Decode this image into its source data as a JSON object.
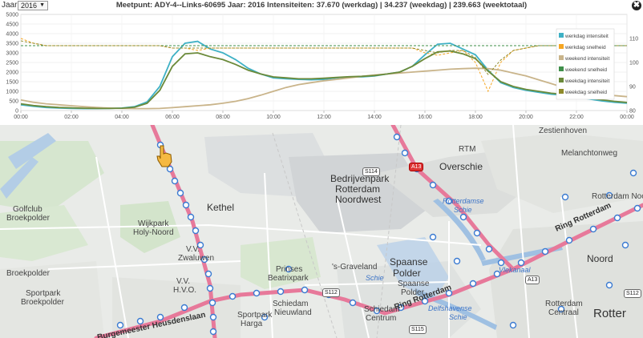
{
  "toolbar": {
    "year_label": "Jaar:",
    "year_value": "2016",
    "year_caret": "▼",
    "close_symbol": "✖",
    "title": "Meetpunt: ADY-4--Links-60695 Jaar: 2016 Intensiteiten: 37.670 (werkdag) | 34.237 (weekdag) | 239.663 (weektotaal)"
  },
  "chart_data": {
    "type": "line",
    "x_ticks": [
      "00:00",
      "02:00",
      "04:00",
      "06:00",
      "08:00",
      "10:00",
      "12:00",
      "14:00",
      "16:00",
      "18:00",
      "20:00",
      "22:00",
      "00:00"
    ],
    "y_left_ticks": [
      "0",
      "500",
      "1000",
      "1500",
      "2000",
      "2500",
      "3000",
      "3500",
      "4000",
      "4500",
      "5000"
    ],
    "y_right_ticks": [
      "80",
      "90",
      "100",
      "110"
    ],
    "ylim_left": [
      0,
      5000
    ],
    "ylim_right": [
      80,
      120
    ],
    "legend_position": "right",
    "x_hours": [
      0,
      0.5,
      1,
      1.5,
      2,
      2.5,
      3,
      3.5,
      4,
      4.5,
      5,
      5.5,
      6,
      6.5,
      7,
      7.5,
      8,
      8.5,
      9,
      9.5,
      10,
      10.5,
      11,
      11.5,
      12,
      12.5,
      13,
      13.5,
      14,
      14.5,
      15,
      15.5,
      16,
      16.5,
      17,
      17.5,
      18,
      18.5,
      19,
      19.5,
      20,
      20.5,
      21,
      21.5,
      22,
      22.5,
      23,
      23.5,
      24
    ],
    "series": [
      {
        "name": "werkdag intensiteit",
        "axis": "left",
        "color": "#3fb1c5",
        "width": 1.8,
        "dash": "",
        "values": [
          300,
          220,
          160,
          130,
          110,
          100,
          100,
          110,
          130,
          200,
          450,
          1250,
          2800,
          3500,
          3600,
          3200,
          3000,
          2650,
          2200,
          1900,
          1700,
          1650,
          1620,
          1600,
          1620,
          1700,
          1750,
          1750,
          1800,
          1900,
          2000,
          2300,
          2900,
          3450,
          3500,
          3200,
          2900,
          2100,
          1450,
          1200,
          1050,
          950,
          850,
          800,
          700,
          600,
          500,
          430,
          380
        ]
      },
      {
        "name": "werkdag snelheid",
        "axis": "right",
        "color": "#f5a623",
        "width": 1,
        "dash": "3,2",
        "values": [
          110,
          108,
          107,
          107,
          107,
          107,
          107,
          107,
          107,
          107,
          107,
          107,
          106,
          106,
          105,
          106,
          106,
          106,
          106,
          106,
          106,
          106,
          106,
          106,
          106,
          106,
          106,
          106,
          106,
          106,
          106,
          106,
          104,
          103,
          104,
          105,
          100,
          88,
          100,
          105,
          106,
          107,
          107,
          107,
          107,
          107,
          107,
          107,
          107
        ]
      },
      {
        "name": "weekend intensiteit",
        "axis": "left",
        "color": "#c9b48a",
        "width": 1.8,
        "dash": "",
        "values": [
          550,
          430,
          350,
          300,
          250,
          200,
          160,
          130,
          110,
          100,
          100,
          110,
          150,
          200,
          250,
          300,
          380,
          480,
          620,
          800,
          1000,
          1200,
          1350,
          1450,
          1550,
          1620,
          1700,
          1780,
          1850,
          1900,
          1950,
          2000,
          2050,
          2100,
          2150,
          2180,
          2200,
          2180,
          2100,
          1950,
          1800,
          1600,
          1400,
          1200,
          1050,
          950,
          850,
          780,
          720
        ]
      },
      {
        "name": "weekend snelheid",
        "axis": "right",
        "color": "#3f8f4a",
        "width": 1,
        "dash": "3,2",
        "values": [
          107,
          107,
          107,
          107,
          107,
          107,
          107,
          107,
          107,
          107,
          107,
          107,
          107,
          107,
          107,
          107,
          107,
          107,
          107,
          107,
          107,
          107,
          107,
          107,
          107,
          107,
          107,
          107,
          107,
          107,
          107,
          107,
          107,
          107,
          107,
          107,
          107,
          107,
          107,
          107,
          107,
          107,
          107,
          107,
          107,
          107,
          107,
          107,
          107
        ]
      },
      {
        "name": "weekdag intensiteit",
        "axis": "left",
        "color": "#6b8a3a",
        "width": 1.8,
        "dash": "",
        "values": [
          350,
          260,
          200,
          160,
          140,
          120,
          110,
          110,
          120,
          170,
          380,
          1050,
          2300,
          2950,
          3000,
          2800,
          2650,
          2400,
          2100,
          1900,
          1750,
          1700,
          1650,
          1650,
          1680,
          1720,
          1760,
          1780,
          1820,
          1900,
          2000,
          2300,
          2700,
          3050,
          3100,
          2950,
          2700,
          2050,
          1500,
          1250,
          1100,
          1000,
          900,
          850,
          750,
          650,
          560,
          480,
          420
        ]
      },
      {
        "name": "weekdag snelheid",
        "axis": "right",
        "color": "#8f8a2a",
        "width": 1,
        "dash": "3,2",
        "values": [
          109,
          108,
          107,
          107,
          107,
          107,
          107,
          107,
          107,
          107,
          107,
          107,
          106,
          106,
          106,
          106,
          106,
          106,
          106,
          106,
          106,
          106,
          106,
          106,
          106,
          106,
          106,
          106,
          106,
          106,
          106,
          106,
          105,
          104,
          105,
          105,
          102,
          95,
          101,
          105,
          106,
          107,
          107,
          107,
          107,
          107,
          107,
          107,
          107
        ]
      }
    ]
  },
  "map": {
    "labels": [
      {
        "text": "Zestienhoven",
        "kind": "normal"
      },
      {
        "text": "RTM",
        "kind": "normal"
      },
      {
        "text": "Melanchtonweg",
        "kind": "normal"
      },
      {
        "text": "Overschie",
        "kind": "big"
      },
      {
        "text": "Bedrijvenpark",
        "kind": "big"
      },
      {
        "text": "Rotterdam",
        "kind": "big"
      },
      {
        "text": "Noordwest",
        "kind": "big"
      },
      {
        "text": "Rotterdamse",
        "kind": "water"
      },
      {
        "text": "Schie",
        "kind": "water"
      },
      {
        "text": "Rotterdam Noord",
        "kind": "normal"
      },
      {
        "text": "Ring Rotterdam",
        "kind": "road"
      },
      {
        "text": "Golfclub",
        "kind": "normal"
      },
      {
        "text": "Broekpolder",
        "kind": "normal"
      },
      {
        "text": "Wijkpark",
        "kind": "normal"
      },
      {
        "text": "Holy-Noord",
        "kind": "normal"
      },
      {
        "text": "Kethel",
        "kind": "big"
      },
      {
        "text": "V.V.",
        "kind": "normal"
      },
      {
        "text": "Zwaluwen",
        "kind": "normal"
      },
      {
        "text": "Broekpolder",
        "kind": "normal"
      },
      {
        "text": "V.V.",
        "kind": "normal"
      },
      {
        "text": "H.V.O.",
        "kind": "normal"
      },
      {
        "text": "Prinses",
        "kind": "normal"
      },
      {
        "text": "Beatrixpark",
        "kind": "normal"
      },
      {
        "text": "'s-Graveland",
        "kind": "normal"
      },
      {
        "text": "Spaanse",
        "kind": "big"
      },
      {
        "text": "Polder",
        "kind": "big"
      },
      {
        "text": "Schie",
        "kind": "water"
      },
      {
        "text": "Spaanse",
        "kind": "normal"
      },
      {
        "text": "Polder",
        "kind": "normal"
      },
      {
        "text": "Noord",
        "kind": "big"
      },
      {
        "text": "Vlekanaal",
        "kind": "water"
      },
      {
        "text": "Sportpark",
        "kind": "normal"
      },
      {
        "text": "Broekpolder",
        "kind": "normal"
      },
      {
        "text": "Sportpark",
        "kind": "normal"
      },
      {
        "text": "Harga",
        "kind": "normal"
      },
      {
        "text": "Schiedam",
        "kind": "normal"
      },
      {
        "text": "Nieuwland",
        "kind": "normal"
      },
      {
        "text": "Schiedam",
        "kind": "normal"
      },
      {
        "text": "Centrum",
        "kind": "normal"
      },
      {
        "text": "Delfshavense",
        "kind": "water"
      },
      {
        "text": "Schie",
        "kind": "water"
      },
      {
        "text": "Rotterdam",
        "kind": "normal"
      },
      {
        "text": "Centraal",
        "kind": "normal"
      },
      {
        "text": "Rotter",
        "kind": "big"
      },
      {
        "text": "Burgemeester Heusdenslaan",
        "kind": "road"
      },
      {
        "text": "Ring Rotterdam",
        "kind": "road"
      }
    ],
    "shields": [
      {
        "text": "S114",
        "kind": "normal"
      },
      {
        "text": "A13",
        "kind": "red"
      },
      {
        "text": "A13",
        "kind": "normal"
      },
      {
        "text": "S112",
        "kind": "normal"
      },
      {
        "text": "S115",
        "kind": "normal"
      },
      {
        "text": "S112",
        "kind": "normal"
      }
    ]
  }
}
